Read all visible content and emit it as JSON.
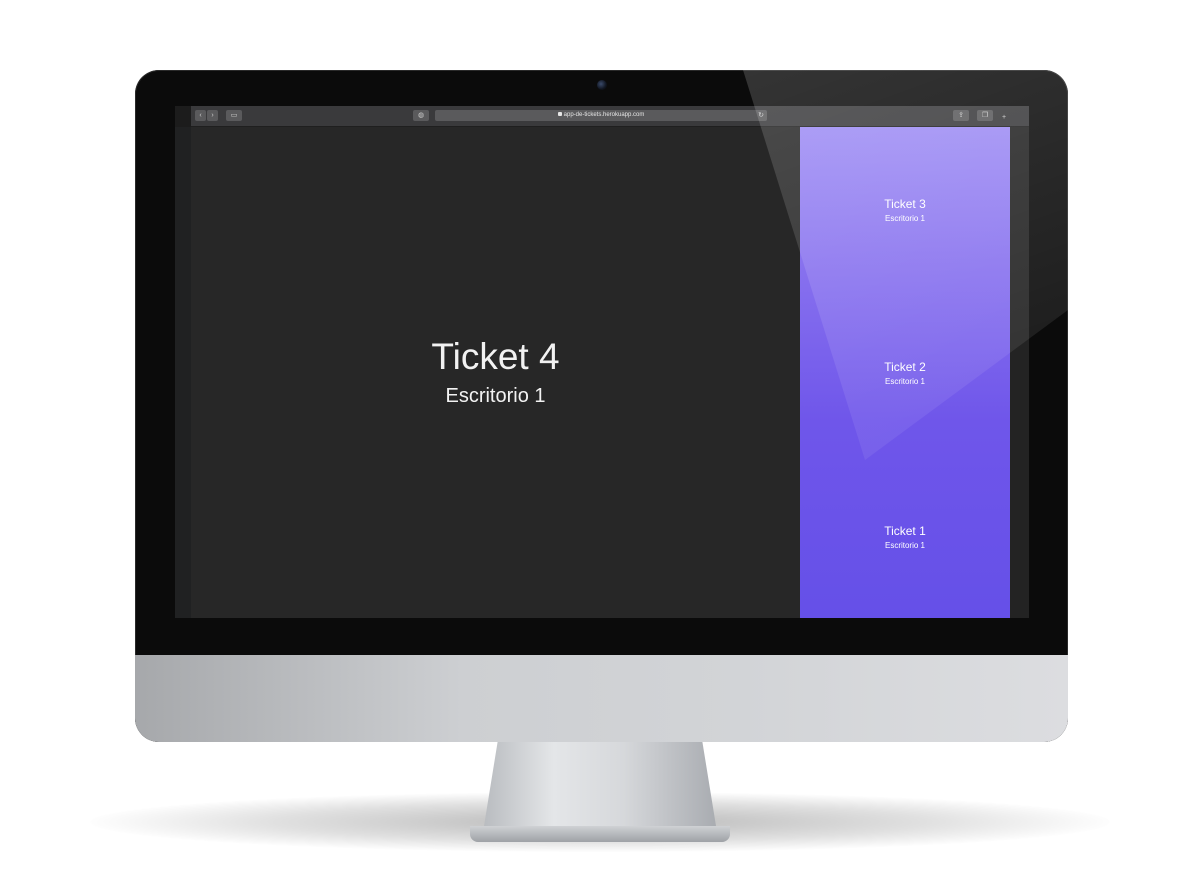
{
  "browser": {
    "url": "app-de-tickets.herokuapp.com"
  },
  "current": {
    "ticket": "Ticket 4",
    "desk": "Escritorio 1"
  },
  "queue": [
    {
      "ticket": "Ticket 3",
      "desk": "Escritorio 1"
    },
    {
      "ticket": "Ticket 2",
      "desk": "Escritorio 1"
    },
    {
      "ticket": "Ticket 1",
      "desk": "Escritorio 1"
    }
  ],
  "colors": {
    "main_bg": "#272727",
    "accent_top": "#9d8cf4",
    "accent_bottom": "#6550e8"
  }
}
